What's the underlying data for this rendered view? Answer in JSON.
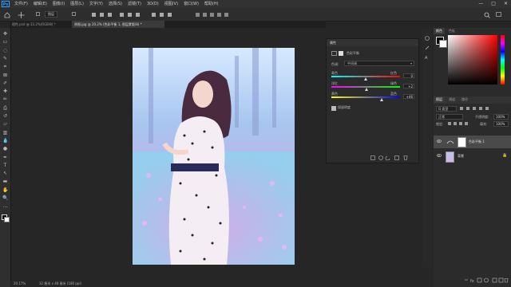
{
  "app": {
    "logo": "Ps"
  },
  "menu": [
    "文件(F)",
    "编辑(E)",
    "图像(I)",
    "图层(L)",
    "文字(Y)",
    "选择(S)",
    "滤镜(T)",
    "3D(D)",
    "视图(V)",
    "窗口(W)",
    "帮助(H)"
  ],
  "window_controls": [
    "—",
    "□",
    "✕"
  ],
  "options": {
    "mode_label": "图层"
  },
  "tabs": [
    {
      "label": "理性.psd @ 33.2%(RGB/8) *",
      "active": false
    },
    {
      "label": "原图.jpg @ 20.2% (色彩平衡 1, 图层蒙版/8) *",
      "active": true
    }
  ],
  "status": {
    "zoom": "20.17%",
    "doc": "32 厘米 x 48 厘米 (180 ppi)"
  },
  "properties": {
    "tabs": [
      "属性"
    ],
    "type_label": "色彩平衡",
    "tone_label": "色调:",
    "tone_value": "中间调",
    "sliders": [
      {
        "left": "青色",
        "right": "红色",
        "value": "0",
        "level": 0,
        "gradient": "linear-gradient(to right,#00ffff,#ff0000)"
      },
      {
        "left": "洋红",
        "right": "绿色",
        "value": "+2",
        "level": 2,
        "gradient": "linear-gradient(to right,#ff00ff,#00ff00)"
      },
      {
        "left": "黄色",
        "right": "蓝色",
        "value": "+46",
        "level": 46,
        "gradient": "linear-gradient(to right,#ffff00,#0000ff)"
      }
    ],
    "preserve_label": "保留明度"
  },
  "color_panel": {
    "tabs": [
      "颜色",
      "色板"
    ]
  },
  "layers_panel": {
    "tabs": [
      "图层",
      "通道",
      "路径"
    ],
    "filter_label": "Q 类型",
    "blend_mode": "正常",
    "opacity_label": "不透明度:",
    "opacity_value": "100%",
    "lock_label": "锁定:",
    "fill_label": "填充:",
    "fill_value": "100%",
    "layers": [
      {
        "name": "色彩平衡 1",
        "visible": true,
        "selected": true
      },
      {
        "name": "背景",
        "visible": true,
        "selected": false
      }
    ]
  },
  "colors": {
    "accent": "#31a8ff",
    "panel": "#2b2b2b",
    "canvas_bg": "#262626"
  }
}
